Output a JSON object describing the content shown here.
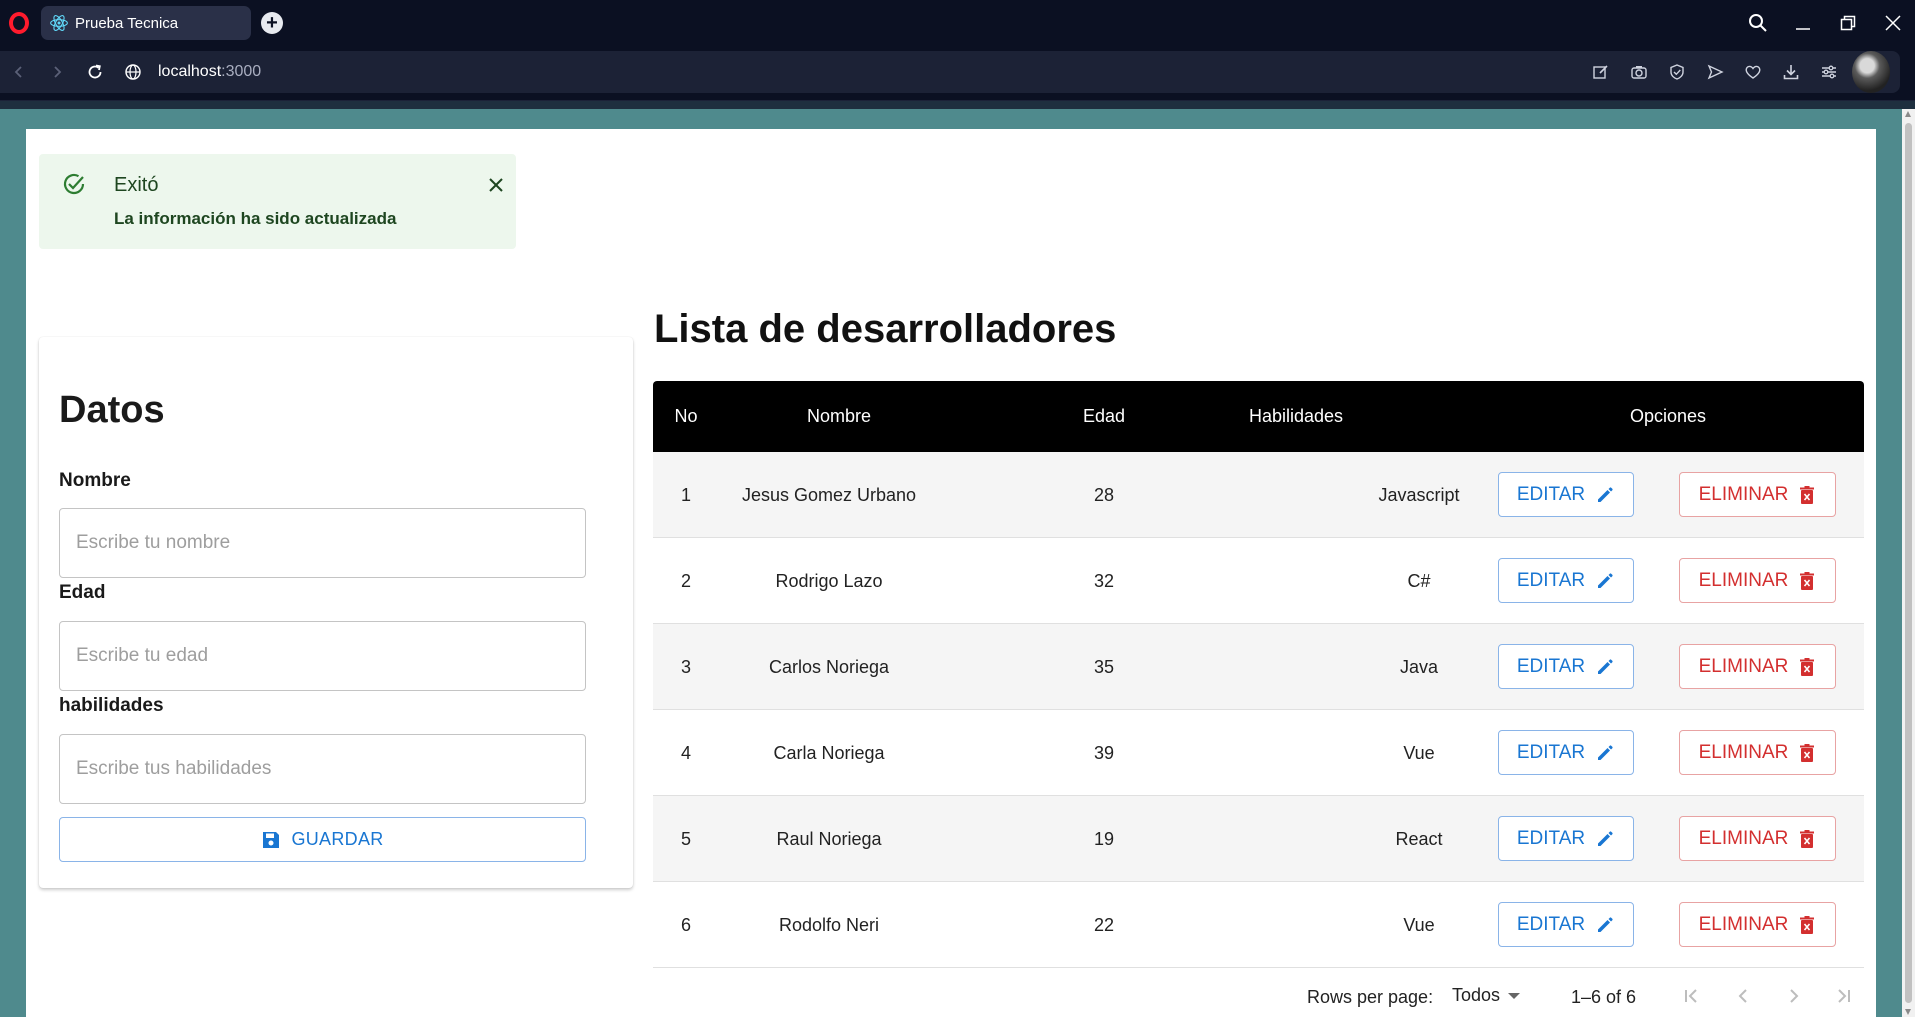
{
  "browser": {
    "tab_title": "Prueba Tecnica",
    "url_host": "localhost",
    "url_port": ":3000"
  },
  "alert": {
    "title": "Exitó",
    "message": "La información ha sido actualizada",
    "color": "#edf7ed"
  },
  "form": {
    "title": "Datos",
    "fields": [
      {
        "label": "Nombre",
        "placeholder": "Escribe tu nombre"
      },
      {
        "label": "Edad",
        "placeholder": "Escribe tu edad"
      },
      {
        "label": "habilidades",
        "placeholder": "Escribe tus habilidades"
      }
    ],
    "save_label": "GUARDAR"
  },
  "list": {
    "title": "Lista de desarrolladores",
    "columns": [
      "No",
      "Nombre",
      "Edad",
      "Habilidades",
      "Opciones"
    ],
    "rows": [
      {
        "no": "1",
        "nombre": "Jesus Gomez Urbano",
        "edad": "28",
        "habilidades": "Javascript"
      },
      {
        "no": "2",
        "nombre": "Rodrigo Lazo",
        "edad": "32",
        "habilidades": "C#"
      },
      {
        "no": "3",
        "nombre": "Carlos Noriega",
        "edad": "35",
        "habilidades": "Java"
      },
      {
        "no": "4",
        "nombre": "Carla Noriega",
        "edad": "39",
        "habilidades": "Vue"
      },
      {
        "no": "5",
        "nombre": "Raul Noriega",
        "edad": "19",
        "habilidades": "React"
      },
      {
        "no": "6",
        "nombre": "Rodolfo Neri",
        "edad": "22",
        "habilidades": "Vue"
      }
    ],
    "edit_label": "EDITAR",
    "delete_label": "ELIMINAR",
    "pagination": {
      "rows_per_page_label": "Rows per page:",
      "rows_per_page_value": "Todos",
      "range": "1–6 of 6"
    }
  },
  "colors": {
    "primary": "#1976d2",
    "error": "#d32f2f",
    "success": "#2e7d32",
    "header_bg": "#000000",
    "page_bg": "#4f8a8d"
  }
}
